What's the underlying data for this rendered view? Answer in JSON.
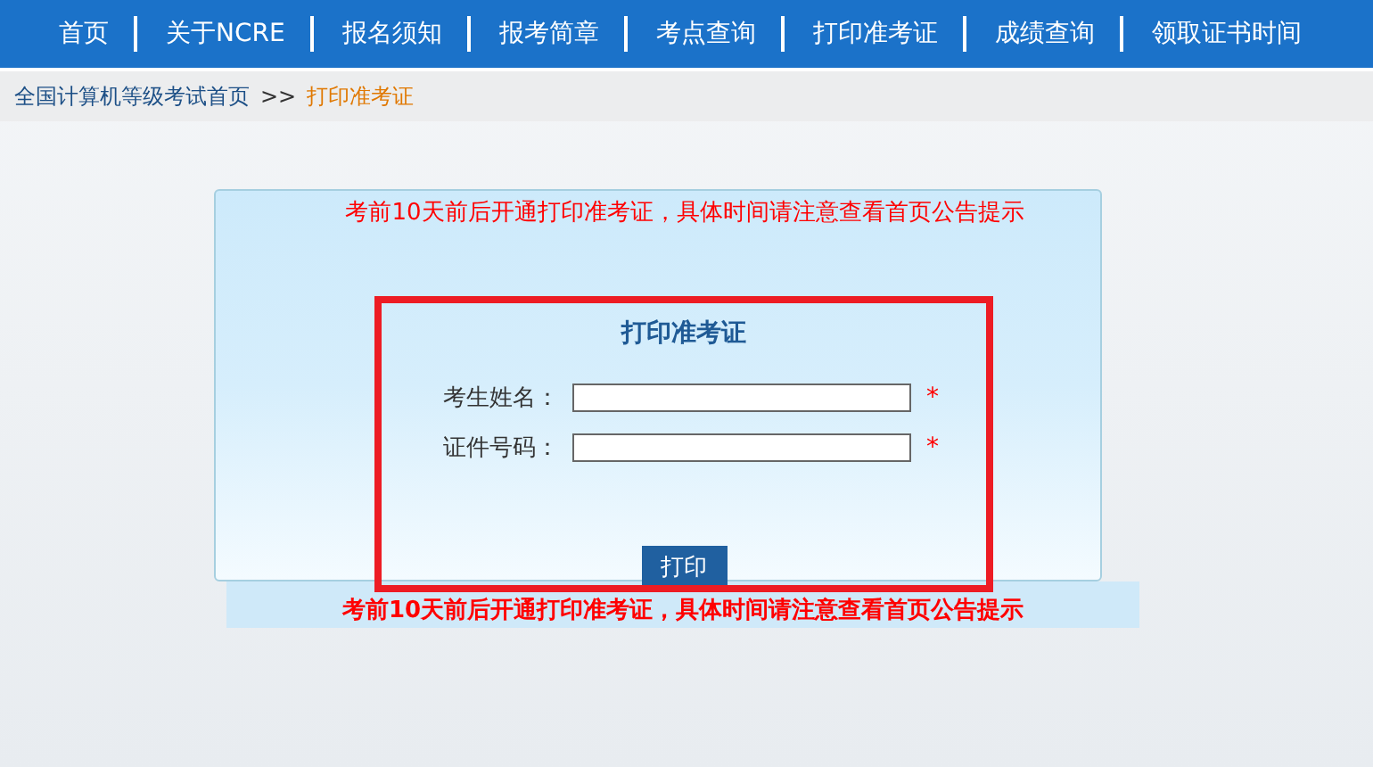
{
  "nav": {
    "items": [
      "首页",
      "关于NCRE",
      "报名须知",
      "报考简章",
      "考点查询",
      "打印准考证",
      "成绩查询",
      "领取证书时间"
    ]
  },
  "breadcrumb": {
    "home": "全国计算机等级考试首页",
    "separator": ">>",
    "current": "打印准考证"
  },
  "panel": {
    "notice": "考前10天前后开通打印准考证，具体时间请注意查看首页公告提示",
    "form": {
      "title": "打印准考证",
      "fields": [
        {
          "label": "考生姓名：",
          "required": "*"
        },
        {
          "label": "证件号码：",
          "required": "*"
        }
      ],
      "button": "打印"
    }
  },
  "footer_notice": "考前10天前后开通打印准考证，具体时间请注意查看首页公告提示"
}
